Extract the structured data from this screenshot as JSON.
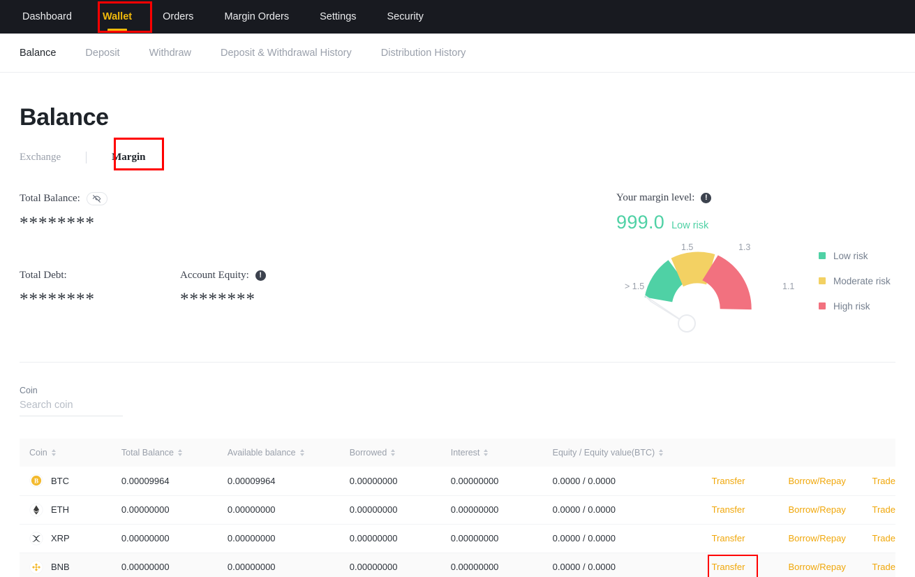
{
  "topnav": {
    "items": [
      {
        "label": "Dashboard",
        "active": false
      },
      {
        "label": "Wallet",
        "active": true
      },
      {
        "label": "Orders",
        "active": false
      },
      {
        "label": "Margin Orders",
        "active": false
      },
      {
        "label": "Settings",
        "active": false
      },
      {
        "label": "Security",
        "active": false
      }
    ],
    "accent_color": "#f0b90b",
    "background_color": "#181a20"
  },
  "subnav": {
    "items": [
      {
        "label": "Balance",
        "active": true
      },
      {
        "label": "Deposit",
        "active": false
      },
      {
        "label": "Withdraw",
        "active": false
      },
      {
        "label": "Deposit & Withdrawal History",
        "active": false
      },
      {
        "label": "Distribution History",
        "active": false
      }
    ]
  },
  "page": {
    "title": "Balance"
  },
  "account_tabs": {
    "exchange_label": "Exchange",
    "margin_label": "Margin",
    "active": "Margin"
  },
  "stats": {
    "total_balance_label": "Total Balance:",
    "total_balance_value": "********",
    "total_debt_label": "Total Debt:",
    "total_debt_value": "********",
    "account_equity_label": "Account Equity:",
    "account_equity_value": "********",
    "hide_icon": "eye-off-icon",
    "info_icon": "info-exclamation-icon"
  },
  "margin_level": {
    "label": "Your margin level:",
    "value": "999.0",
    "risk_text": "Low risk",
    "risk_color": "#4fd1a5",
    "info_icon": "info-exclamation-icon",
    "ticks": {
      "left": "> 1.5",
      "mid_left": "1.5",
      "mid_right": "1.3",
      "right": "1.1"
    },
    "legend": [
      {
        "label": "Low risk",
        "color": "#4fd1a5"
      },
      {
        "label": "Moderate risk",
        "color": "#f3d163"
      },
      {
        "label": "High risk",
        "color": "#f2717f"
      }
    ]
  },
  "chart_data": {
    "type": "gauge",
    "title": "Your margin level",
    "value": 999.0,
    "value_display": "999.0",
    "status": "Low risk",
    "needle_zone": "> 1.5",
    "axis_ticks": [
      "> 1.5",
      "1.5",
      "1.3",
      "1.1"
    ],
    "segments": [
      {
        "name": "Low risk",
        "range": "> 1.5",
        "color": "#4fd1a5"
      },
      {
        "name": "Moderate risk",
        "range": "1.3 - 1.5",
        "color": "#f3d163"
      },
      {
        "name": "High risk",
        "range": "1.1 - 1.3",
        "color": "#f2717f"
      }
    ],
    "legend_position": "right"
  },
  "search": {
    "label": "Coin",
    "placeholder": "Search coin",
    "value": ""
  },
  "table": {
    "columns": [
      {
        "label": "Coin",
        "sortable": true
      },
      {
        "label": "Total Balance",
        "sortable": true
      },
      {
        "label": "Available balance",
        "sortable": true
      },
      {
        "label": "Borrowed",
        "sortable": true
      },
      {
        "label": "Interest",
        "sortable": true
      },
      {
        "label": "Equity / Equity value(BTC)",
        "sortable": true
      }
    ],
    "actions": {
      "transfer": "Transfer",
      "borrow_repay": "Borrow/Repay",
      "trade": "Trade"
    },
    "rows": [
      {
        "coin": "BTC",
        "icon": "btc-coin-icon",
        "total_balance": "0.00009964",
        "available_balance": "0.00009964",
        "borrowed": "0.00000000",
        "interest": "0.00000000",
        "equity": "0.0000 / 0.0000",
        "highlighted": false
      },
      {
        "coin": "ETH",
        "icon": "eth-coin-icon",
        "total_balance": "0.00000000",
        "available_balance": "0.00000000",
        "borrowed": "0.00000000",
        "interest": "0.00000000",
        "equity": "0.0000 / 0.0000",
        "highlighted": false
      },
      {
        "coin": "XRP",
        "icon": "xrp-coin-icon",
        "total_balance": "0.00000000",
        "available_balance": "0.00000000",
        "borrowed": "0.00000000",
        "interest": "0.00000000",
        "equity": "0.0000 / 0.0000",
        "highlighted": false
      },
      {
        "coin": "BNB",
        "icon": "bnb-coin-icon",
        "total_balance": "0.00000000",
        "available_balance": "0.00000000",
        "borrowed": "0.00000000",
        "interest": "0.00000000",
        "equity": "0.0000 / 0.0000",
        "highlighted": true
      }
    ]
  }
}
